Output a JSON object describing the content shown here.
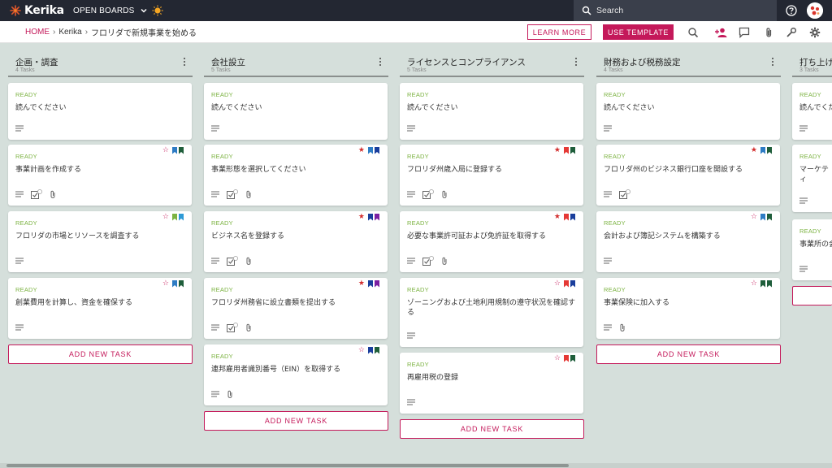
{
  "topbar": {
    "logo_text": "Kerika",
    "open_boards_label": "OPEN BOARDS",
    "search_placeholder": "Search"
  },
  "breadcrumb": {
    "home": "HOME",
    "org": "Kerika",
    "board": "フロリダで新規事業を始める"
  },
  "header": {
    "learn_more_label": "LEARN MORE",
    "use_template_label": "USE TEMPLATE"
  },
  "icons": [
    "search-icon",
    "add-person-icon",
    "chat-icon",
    "attachment-icon",
    "wrench-icon",
    "gear-icon"
  ],
  "colors": {
    "accent": "#c4195a",
    "status_ready": "#7cb342",
    "topbar": "#232732",
    "board_bg": "#d5dfdb"
  },
  "add_task_label": "ADD NEW TASK",
  "columns": [
    {
      "title": "企画・調査",
      "count": "4 Tasks",
      "cards": [
        {
          "status": "READY",
          "title": "読んでください"
        },
        {
          "status": "READY",
          "title": "事業計画を作成する"
        },
        {
          "status": "READY",
          "title": "フロリダの市場とリソースを調査する"
        },
        {
          "status": "READY",
          "title": "創業費用を計算し、資金を確保する"
        }
      ]
    },
    {
      "title": "会社設立",
      "count": "5 Tasks",
      "cards": [
        {
          "status": "READY",
          "title": "読んでください"
        },
        {
          "status": "READY",
          "title": "事業形態を選択してください"
        },
        {
          "status": "READY",
          "title": "ビジネス名を登録する"
        },
        {
          "status": "READY",
          "title": "フロリダ州務省に設立書類を提出する"
        },
        {
          "status": "READY",
          "title": "連邦雇用者識別番号（EIN）を取得する"
        }
      ]
    },
    {
      "title": "ライセンスとコンプライアンス",
      "count": "5 Tasks",
      "cards": [
        {
          "status": "READY",
          "title": "読んでください"
        },
        {
          "status": "READY",
          "title": "フロリダ州歳入局に登録する"
        },
        {
          "status": "READY",
          "title": "必要な事業許可証および免許証を取得する"
        },
        {
          "status": "READY",
          "title": "ゾーニングおよび土地利用規制の遵守状況を確認する"
        },
        {
          "status": "READY",
          "title": "再雇用税の登録"
        }
      ]
    },
    {
      "title": "財務および税務設定",
      "count": "4 Tasks",
      "cards": [
        {
          "status": "READY",
          "title": "読んでください"
        },
        {
          "status": "READY",
          "title": "フロリダ州のビジネス銀行口座を開設する"
        },
        {
          "status": "READY",
          "title": "会計および簿記システムを構築する"
        },
        {
          "status": "READY",
          "title": "事業保険に加入する"
        }
      ]
    },
    {
      "title": "打ち上げ",
      "count": "3 Tasks",
      "cards": [
        {
          "status": "READY",
          "title": "読んでください"
        },
        {
          "status": "READY",
          "title": "マーケティ"
        },
        {
          "status": "READY",
          "title": "事業所の会"
        }
      ]
    }
  ]
}
